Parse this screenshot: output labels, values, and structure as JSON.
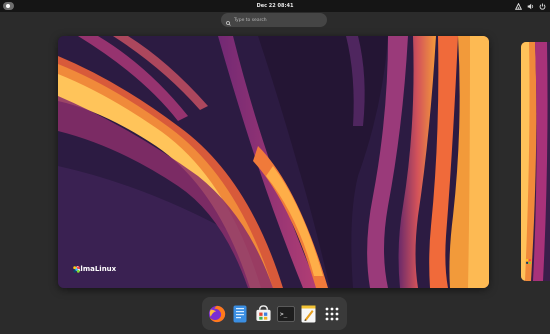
{
  "topbar": {
    "clock": "Dec 22  08:41",
    "tray_icons": [
      "network-icon",
      "volume-icon",
      "power-icon"
    ]
  },
  "search": {
    "placeholder": "Type to search"
  },
  "workspace": {
    "brand_name": "AlmaLinux"
  },
  "dash": {
    "apps": [
      {
        "name": "Firefox",
        "icon": "firefox-icon"
      },
      {
        "name": "Files",
        "icon": "files-icon"
      },
      {
        "name": "Software",
        "icon": "software-icon"
      },
      {
        "name": "Terminal",
        "icon": "terminal-icon",
        "text": ">_"
      },
      {
        "name": "Text Editor",
        "icon": "text-editor-icon"
      },
      {
        "name": "Show Apps",
        "icon": "app-grid-icon"
      }
    ]
  },
  "colors": {
    "background": "#2b2b2b",
    "topbar": "#151515",
    "dash": "#3a3a3a",
    "wallpaper_dark": "#2a1a3e",
    "wallpaper_orange": "#f08a3a",
    "wallpaper_magenta": "#a8327a"
  }
}
